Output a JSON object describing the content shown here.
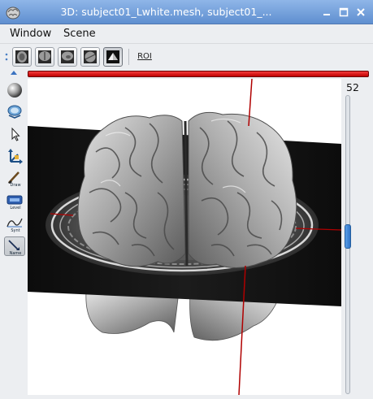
{
  "window": {
    "title": "3D: subject01_Lwhite.mesh, subject01_...",
    "controls": [
      "minimize-icon",
      "maximize-icon",
      "close-icon"
    ]
  },
  "menu": {
    "items": [
      "Window",
      "Scene"
    ]
  },
  "toolbar": {
    "view_buttons": [
      "axial-view-icon",
      "coronal-view-icon",
      "sagittal-view-icon",
      "oblique-view-icon",
      "3d-view-icon"
    ],
    "active_view": "3d-view-icon",
    "roi_label": "ROI"
  },
  "left_tools": {
    "items": [
      {
        "icon": "sphere-icon",
        "caption": ""
      },
      {
        "icon": "3d-rotate-icon",
        "caption": ""
      },
      {
        "icon": "pointer-icon",
        "caption": ""
      },
      {
        "icon": "axes-icon",
        "caption": ""
      },
      {
        "icon": "brush-icon",
        "caption": "Draw"
      },
      {
        "icon": "level-icon",
        "caption": "Level"
      },
      {
        "icon": "synthesis-icon",
        "caption": "Synt"
      },
      {
        "icon": "name-icon",
        "caption": "Name"
      }
    ],
    "active_tool": "name-icon"
  },
  "slider": {
    "value": "52",
    "level": 0.47
  },
  "colors": {
    "titlebar": "#6f9bd8",
    "slice_bar": "#e02020",
    "cursor_line": "#b00000",
    "viewport_bg": "#ffffff"
  }
}
